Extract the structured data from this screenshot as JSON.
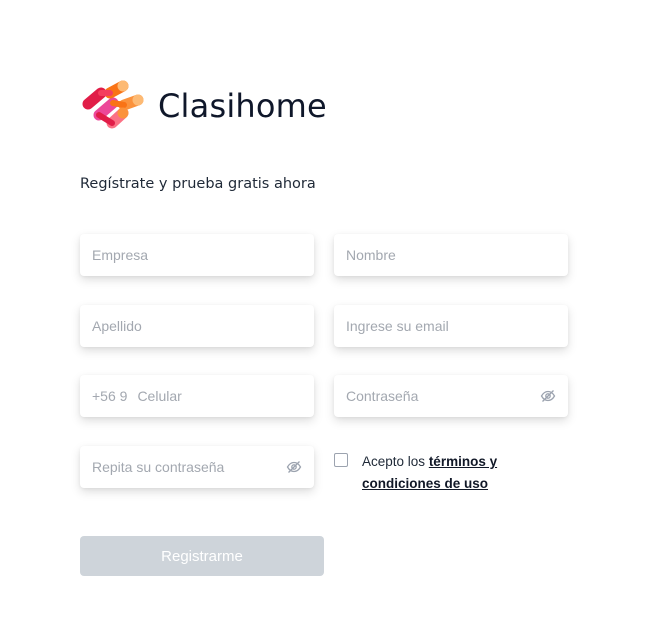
{
  "brand": {
    "name": "Clasihome",
    "logo_colors": [
      "#e11d48",
      "#f472b6",
      "#fb923c",
      "#fdba74"
    ]
  },
  "form": {
    "subtitle": "Regístrate y prueba gratis ahora",
    "fields": {
      "company": {
        "placeholder": "Empresa",
        "value": ""
      },
      "name": {
        "placeholder": "Nombre",
        "value": ""
      },
      "lastname": {
        "placeholder": "Apellido",
        "value": ""
      },
      "email": {
        "placeholder": "Ingrese su email",
        "value": ""
      },
      "phone": {
        "prefix": "+56 9",
        "placeholder": "Celular",
        "value": ""
      },
      "password": {
        "placeholder": "Contraseña",
        "value": "",
        "icon": "eye-off-icon"
      },
      "repeat_password": {
        "placeholder": "Repita su contraseña",
        "value": "",
        "icon": "eye-off-icon"
      }
    },
    "terms": {
      "checked": false,
      "prefix_text": "Acepto los",
      "link_text": "términos y condiciones de uso"
    },
    "submit_label": "Registrarme",
    "submit_color": "#ced4da"
  }
}
